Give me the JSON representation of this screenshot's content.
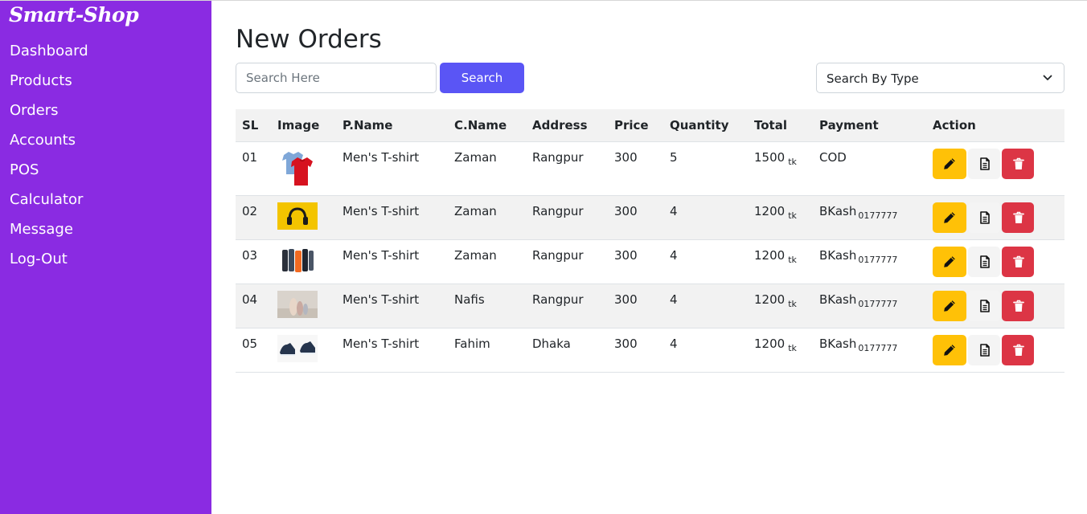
{
  "sidebar": {
    "brand": "Smart-Shop",
    "items": [
      "Dashboard",
      "Products",
      "Orders",
      "Accounts",
      "POS",
      "Calculator",
      "Message",
      "Log-Out"
    ],
    "bg_color": "#8a2be2"
  },
  "main": {
    "title": "New Orders",
    "search_placeholder": "Search Here",
    "search_button": "Search",
    "type_select": "Search By Type",
    "search_button_color": "#5a55f5"
  },
  "table": {
    "headers": [
      "SL",
      "Image",
      "P.Name",
      "C.Name",
      "Address",
      "Price",
      "Quantity",
      "Total",
      "Payment",
      "Action"
    ],
    "rows": [
      {
        "sl": "01",
        "image": "tshirt-image",
        "pname": "Men's T-shirt",
        "cname": "Zaman",
        "address": "Rangpur",
        "price": "300",
        "quantity": "5",
        "total": "1500",
        "unit": "tk",
        "payment": "COD",
        "account": ""
      },
      {
        "sl": "02",
        "image": "headphones-image",
        "pname": "Men's T-shirt",
        "cname": "Zaman",
        "address": "Rangpur",
        "price": "300",
        "quantity": "4",
        "total": "1200",
        "unit": "tk",
        "payment": "BKash",
        "account": "0177777"
      },
      {
        "sl": "03",
        "image": "bottles-image",
        "pname": "Men's T-shirt",
        "cname": "Zaman",
        "address": "Rangpur",
        "price": "300",
        "quantity": "4",
        "total": "1200",
        "unit": "tk",
        "payment": "BKash",
        "account": "0177777"
      },
      {
        "sl": "04",
        "image": "vases-image",
        "pname": "Men's T-shirt",
        "cname": "Nafis",
        "address": "Rangpur",
        "price": "300",
        "quantity": "4",
        "total": "1200",
        "unit": "tk",
        "payment": "BKash",
        "account": "0177777"
      },
      {
        "sl": "05",
        "image": "sneakers-image",
        "pname": "Men's T-shirt",
        "cname": "Fahim",
        "address": "Dhaka",
        "price": "300",
        "quantity": "4",
        "total": "1200",
        "unit": "tk",
        "payment": "BKash",
        "account": "0177777"
      }
    ],
    "actions": [
      "pencil-icon",
      "document-icon",
      "trash-icon"
    ],
    "action_colors": {
      "edit": "#ffc107",
      "view": "#f4f4f4",
      "delete": "#dc3545"
    }
  }
}
